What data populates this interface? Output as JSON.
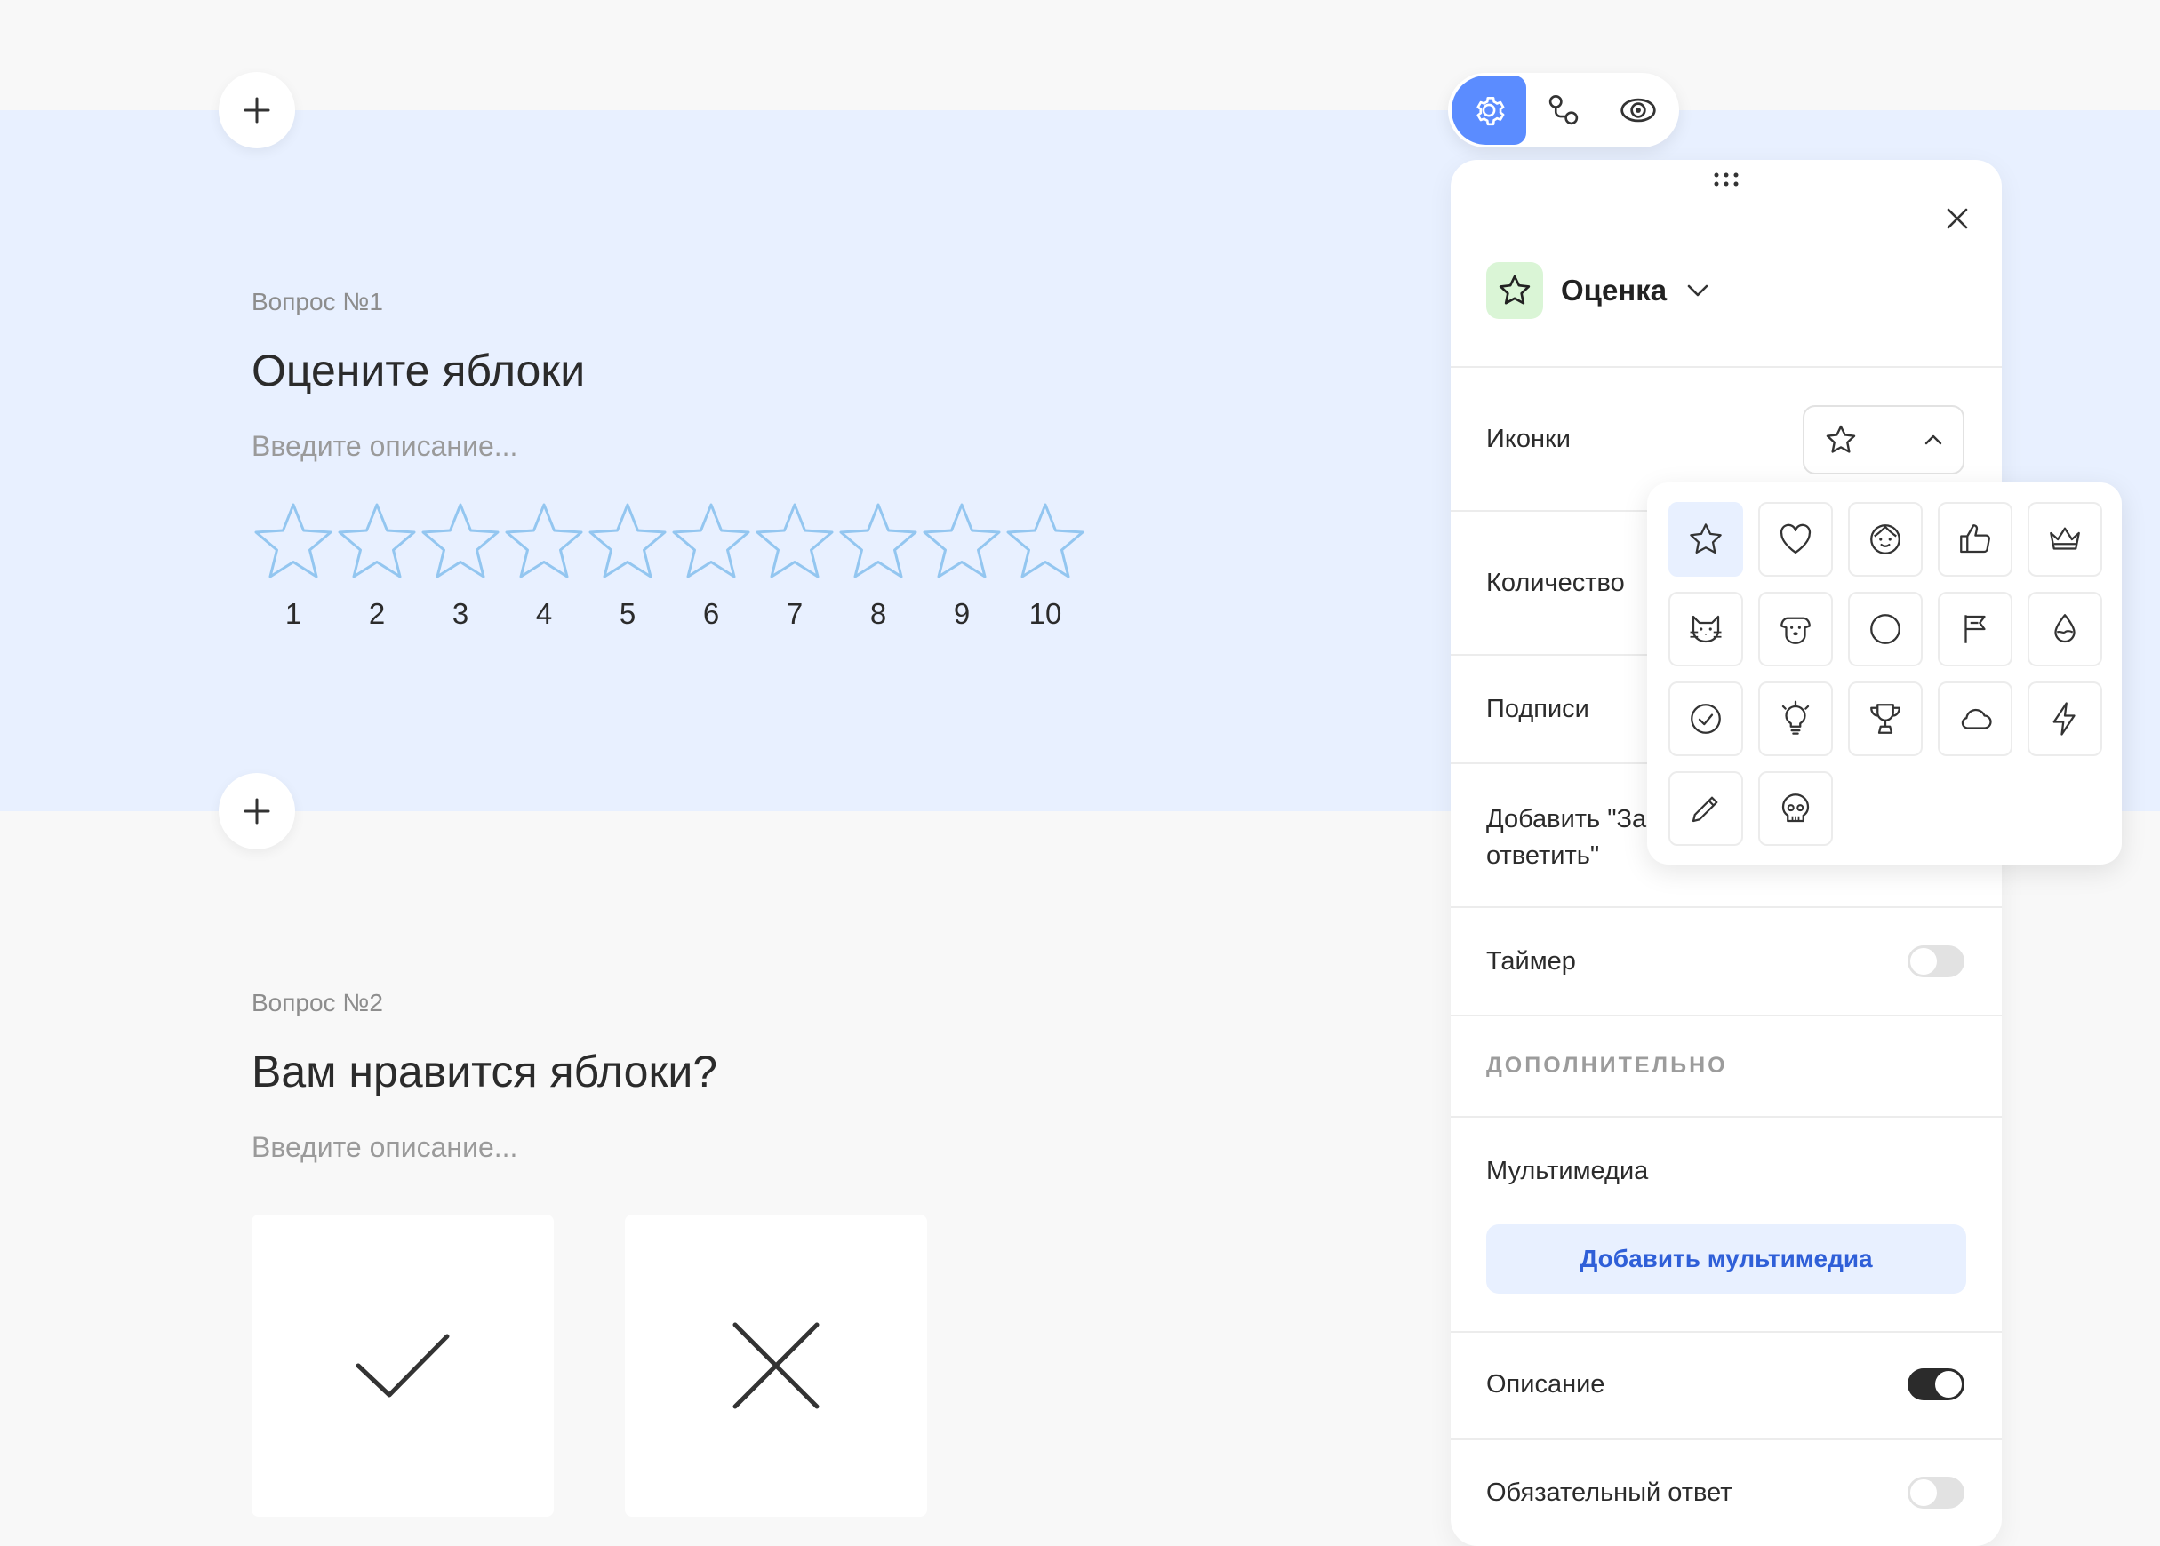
{
  "questions": [
    {
      "number": "Вопрос №1",
      "title": "Оцените яблоки",
      "description_placeholder": "Введите описание...",
      "rating_labels": [
        "1",
        "2",
        "3",
        "4",
        "5",
        "6",
        "7",
        "8",
        "9",
        "10"
      ]
    },
    {
      "number": "Вопрос №2",
      "title": "Вам нравится яблоки?",
      "description_placeholder": "Введите описание..."
    }
  ],
  "toolbar": {
    "icons": [
      "gear-icon",
      "logic-icon",
      "eye-icon"
    ],
    "active": "gear-icon"
  },
  "panel": {
    "type_label": "Оценка",
    "rows": {
      "icons": "Иконки",
      "count": "Количество",
      "labels": "Подписи",
      "skip": "Добавить \"За\nответить\"",
      "timer": "Таймер",
      "section_additional": "ДОПОЛНИТЕЛЬНО",
      "media": "Мультимедиа",
      "media_button": "Добавить мультимедиа",
      "description": "Описание",
      "required": "Обязательный ответ"
    },
    "toggles": {
      "timer": false,
      "description": true,
      "required": false
    }
  },
  "icon_picker": {
    "selected": "star-icon",
    "options": [
      "star-icon",
      "heart-icon",
      "smile-icon",
      "thumbs-up-icon",
      "crown-icon",
      "cat-icon",
      "dog-icon",
      "circle-icon",
      "flag-icon",
      "drop-icon",
      "check-circle-icon",
      "lightbulb-icon",
      "trophy-icon",
      "cloud-icon",
      "lightning-icon",
      "pencil-icon",
      "skull-icon"
    ]
  },
  "colors": {
    "accent": "#5b8cff",
    "highlight": "#e8f0ff",
    "star_outline": "#93c6f0",
    "type_badge": "#daf5d6"
  }
}
